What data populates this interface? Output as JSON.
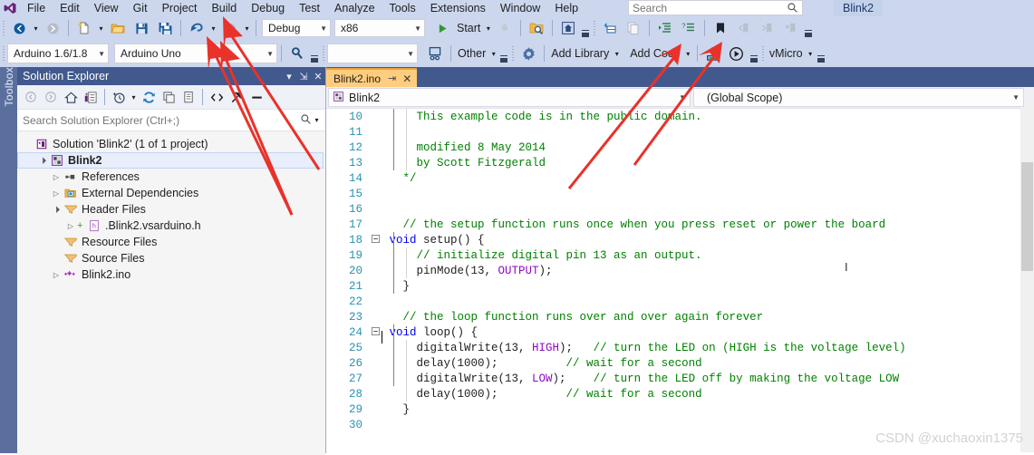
{
  "window": {
    "title": "Blink2",
    "watermark": "CSDN @xuchaoxin1375"
  },
  "menu": {
    "items": [
      "File",
      "Edit",
      "View",
      "Git",
      "Project",
      "Build",
      "Debug",
      "Test",
      "Analyze",
      "Tools",
      "Extensions",
      "Window",
      "Help"
    ]
  },
  "search": {
    "placeholder": "Search",
    "value": "",
    "icon": "search-icon"
  },
  "toolbar_standard": {
    "back_label": "←",
    "forward_label": "→",
    "new_item_tooltip": "New Item",
    "open_tooltip": "Open File",
    "save_tooltip": "Save",
    "save_all_tooltip": "Save All",
    "undo_tooltip": "Undo",
    "redo_tooltip": "Redo",
    "configuration": "Debug",
    "platform": "x86",
    "start_label": "Start",
    "icons": [
      "navigate-back-icon",
      "navigate-forward-icon",
      "new-item-icon",
      "open-file-icon",
      "save-icon",
      "save-all-icon",
      "undo-icon",
      "redo-icon",
      "run-start-icon",
      "hot-reload-icon",
      "find-in-files-icon",
      "home-icon",
      "attach-icon",
      "copy-icon",
      "indent-icon",
      "comment-icon",
      "bookmark-icon",
      "prev-bookmark-icon",
      "next-bookmark-icon",
      "clear-bookmark-icon"
    ]
  },
  "toolbar_vmicro": {
    "ide_version": "Arduino 1.6/1.8",
    "board": "Arduino Uno",
    "port": "",
    "other_label": "Other",
    "add_library_label": "Add Library",
    "add_code_label": "Add Code",
    "vmicro_label": "vMicro",
    "icons": [
      "magnifier-icon",
      "board-explorer-icon",
      "settings-gear-icon",
      "upload-icon",
      "serial-monitor-icon"
    ]
  },
  "toolbox": {
    "label": "Toolbox"
  },
  "solution_explorer": {
    "title": "Solution Explorer",
    "header_buttons": [
      "chevron-down-icon",
      "pin-icon",
      "close-icon"
    ],
    "toolbar_icons": [
      "back-icon",
      "forward-icon",
      "home-icon",
      "solution-explorer-icon",
      "pending-changes-icon",
      "refresh-icon",
      "collapse-all-icon",
      "show-all-files-icon",
      "view-code-icon",
      "properties-icon",
      "preview-icon"
    ],
    "search_placeholder": "Search Solution Explorer (Ctrl+;)",
    "search_value": "",
    "tree": [
      {
        "label": "Solution 'Blink2' (1 of 1 project)",
        "indent": 0,
        "twisty": "",
        "icon": "solution-icon",
        "bold": false,
        "selected": false
      },
      {
        "label": "Blink2",
        "indent": 1,
        "twisty": "expanded",
        "icon": "project-icon",
        "bold": true,
        "selected": true
      },
      {
        "label": "References",
        "indent": 2,
        "twisty": "collapsed",
        "icon": "references-icon",
        "bold": false,
        "selected": false
      },
      {
        "label": "External Dependencies",
        "indent": 2,
        "twisty": "collapsed",
        "icon": "folder-dependencies-icon",
        "bold": false,
        "selected": false
      },
      {
        "label": "Header Files",
        "indent": 2,
        "twisty": "expanded",
        "icon": "filter-folder-icon",
        "bold": false,
        "selected": false
      },
      {
        "label": ".Blink2.vsarduino.h",
        "indent": 3,
        "twisty": "collapsed",
        "icon": "header-file-icon",
        "bold": false,
        "selected": false
      },
      {
        "label": "Resource Files",
        "indent": 2,
        "twisty": "",
        "icon": "filter-folder-icon",
        "bold": false,
        "selected": false
      },
      {
        "label": "Source Files",
        "indent": 2,
        "twisty": "",
        "icon": "filter-folder-icon",
        "bold": false,
        "selected": false
      },
      {
        "label": "Blink2.ino",
        "indent": 2,
        "twisty": "collapsed",
        "icon": "ino-file-icon",
        "bold": false,
        "selected": false
      }
    ]
  },
  "editor": {
    "tab": {
      "label": "Blink2.ino",
      "pin": "pin-icon",
      "close": "close-icon"
    },
    "nav_left": {
      "value": "Blink2",
      "icon": "project-icon"
    },
    "nav_right": {
      "value": "(Global Scope)"
    },
    "first_line_number": 10,
    "lines": [
      {
        "n": 10,
        "fold": "",
        "tokens": [
          {
            "t": "     This example code is in the public domain.",
            "c": "cm"
          }
        ]
      },
      {
        "n": 11,
        "fold": "",
        "tokens": []
      },
      {
        "n": 12,
        "fold": "",
        "tokens": [
          {
            "t": "     modified 8 May 2014",
            "c": "cm"
          }
        ]
      },
      {
        "n": 13,
        "fold": "",
        "tokens": [
          {
            "t": "     by Scott Fitzgerald",
            "c": "cm"
          }
        ]
      },
      {
        "n": 14,
        "fold": "",
        "tokens": [
          {
            "t": "   */",
            "c": "cm"
          }
        ]
      },
      {
        "n": 15,
        "fold": "",
        "tokens": []
      },
      {
        "n": 16,
        "fold": "",
        "tokens": []
      },
      {
        "n": 17,
        "fold": "",
        "tokens": [
          {
            "t": "   // the setup function runs once when you press reset or power the board",
            "c": "cm"
          }
        ]
      },
      {
        "n": 18,
        "fold": "minus",
        "tokens": [
          {
            "t": " ",
            "c": "pl"
          },
          {
            "t": "void",
            "c": "kw"
          },
          {
            "t": " setup() {",
            "c": "pl"
          }
        ]
      },
      {
        "n": 19,
        "fold": "",
        "tokens": [
          {
            "t": "     // initialize digital pin 13 as an output.",
            "c": "cm"
          }
        ]
      },
      {
        "n": 20,
        "fold": "",
        "tokens": [
          {
            "t": "     pinMode(13, ",
            "c": "pl"
          },
          {
            "t": "OUTPUT",
            "c": "mc"
          },
          {
            "t": ");",
            "c": "pl"
          }
        ]
      },
      {
        "n": 21,
        "fold": "",
        "tokens": [
          {
            "t": "   }",
            "c": "pl"
          }
        ]
      },
      {
        "n": 22,
        "fold": "",
        "tokens": []
      },
      {
        "n": 23,
        "fold": "",
        "tokens": [
          {
            "t": "   // the loop function runs over and over again forever",
            "c": "cm"
          }
        ]
      },
      {
        "n": 24,
        "fold": "minus",
        "tokens": [
          {
            "t": " ",
            "c": "pl"
          },
          {
            "t": "void",
            "c": "kw"
          },
          {
            "t": " loop() {",
            "c": "pl"
          }
        ]
      },
      {
        "n": 25,
        "fold": "",
        "tokens": [
          {
            "t": "     digitalWrite(13, ",
            "c": "pl"
          },
          {
            "t": "HIGH",
            "c": "mc"
          },
          {
            "t": ");   ",
            "c": "pl"
          },
          {
            "t": "// turn the LED on (HIGH is the voltage level)",
            "c": "cm"
          }
        ]
      },
      {
        "n": 26,
        "fold": "",
        "tokens": [
          {
            "t": "     delay(1000);          ",
            "c": "pl"
          },
          {
            "t": "// wait for a second",
            "c": "cm"
          }
        ]
      },
      {
        "n": 27,
        "fold": "",
        "tokens": [
          {
            "t": "     digitalWrite(13, ",
            "c": "pl"
          },
          {
            "t": "LOW",
            "c": "mc"
          },
          {
            "t": ");    ",
            "c": "pl"
          },
          {
            "t": "// turn the LED off by making the voltage LOW",
            "c": "cm"
          }
        ]
      },
      {
        "n": 28,
        "fold": "",
        "tokens": [
          {
            "t": "     delay(1000);          ",
            "c": "pl"
          },
          {
            "t": "// wait for a second",
            "c": "cm"
          }
        ]
      },
      {
        "n": 29,
        "fold": "",
        "tokens": [
          {
            "t": "   }",
            "c": "pl"
          }
        ]
      },
      {
        "n": 30,
        "fold": "",
        "tokens": []
      }
    ]
  },
  "colors": {
    "chrome": "#ccd7ee",
    "accent": "#42598d",
    "tab_active": "#ffcd7d",
    "comment": "#008000",
    "keyword": "#0000ff",
    "macro": "#8f08c4",
    "linenumber": "#2b91af",
    "annotation_arrow": "#e8322a"
  }
}
